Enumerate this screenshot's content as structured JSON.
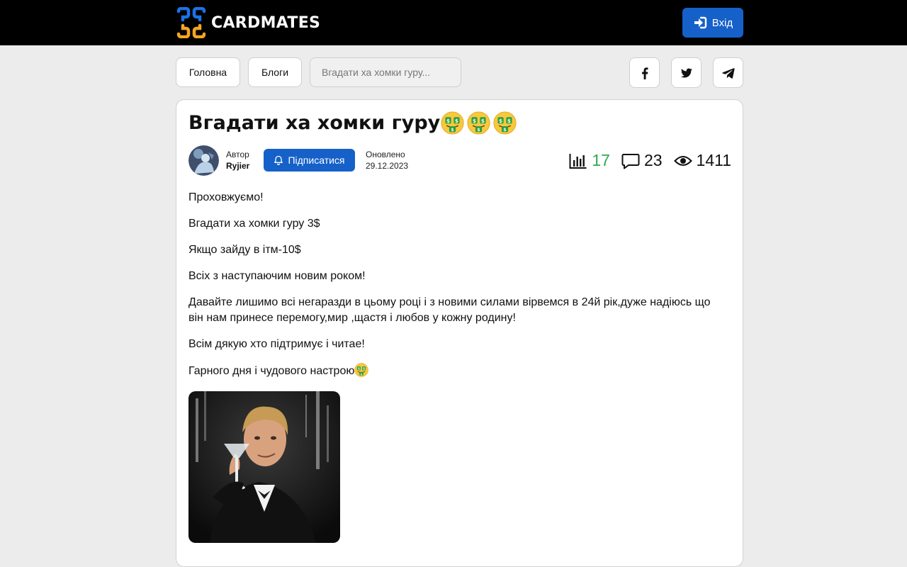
{
  "header": {
    "logo_text": "CARDMATES",
    "login_label": "Вхід",
    "accent_color": "#1561c9",
    "logo_colors": [
      "#1a73e8",
      "#f5a623"
    ]
  },
  "nav": {
    "home_label": "Головна",
    "blogs_label": "Блоги",
    "search_placeholder": "Вгадати ха хомки гуру..."
  },
  "social": [
    "facebook-icon",
    "twitter-icon",
    "telegram-icon"
  ],
  "post": {
    "title": "Вгадати ха хомки гуру",
    "title_emoji": "money-mouth-face",
    "author_label": "Автор",
    "author_name": "Ryjier",
    "subscribe_label": "Підписатися",
    "updated_label": "Оновлено",
    "updated_date": "29.12.2023",
    "stats": {
      "rating": "17",
      "comments": "23",
      "views": "1411"
    },
    "paragraphs": [
      "Проховжуємо!",
      "Вгадати ха хомки гуру 3$",
      "Якщо зайду в ітм-10$",
      "Всіх з наступаючим новим роком!",
      "Давайте лишимо всі негаразди в цьому році і з новими силами вірвемся в 24й рік,дуже надіюсь  що він нам принесе перемогу,мир ,щастя і любов у кожну родину!",
      "Всім дякую хто підтримує і читае!",
      "Гарного дня і чудового настрою"
    ]
  }
}
